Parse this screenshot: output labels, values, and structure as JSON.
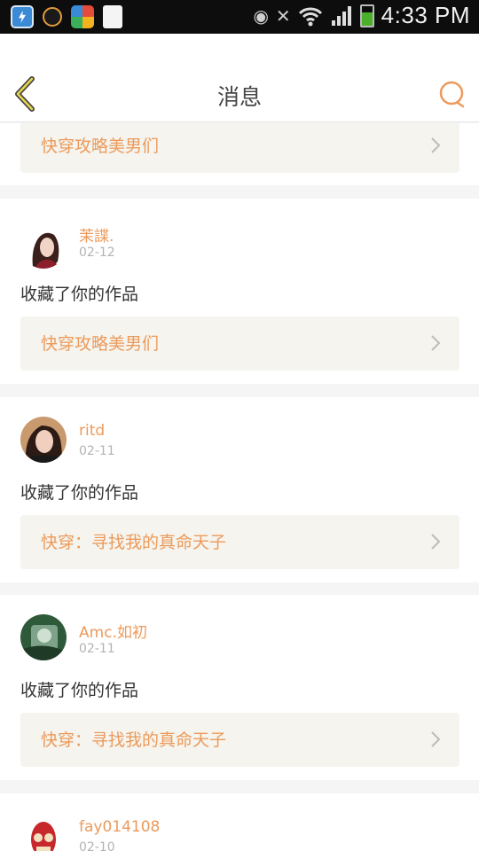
{
  "status_bar": {
    "time": "4:33 PM",
    "icons": [
      "shield-app-icon",
      "face-app-icon",
      "pinwheel-app-icon",
      "document-app-icon",
      "eye-icon",
      "mute-icon",
      "wifi-icon",
      "signal-icon",
      "battery-icon"
    ]
  },
  "header": {
    "title": "消息",
    "back_icon": "chevron-left-icon",
    "search_icon": "search-icon"
  },
  "colors": {
    "accent": "#ec9a5b",
    "back_icon": "#c9b400",
    "link_bg": "#f5f4ee"
  },
  "messages": [
    {
      "partial": true,
      "work_title": "快穿攻略美男们"
    },
    {
      "user": "茉諜.",
      "date": "02-12",
      "action": "收藏了你的作品",
      "work_title": "快穿攻略美男们"
    },
    {
      "user": "ritd",
      "date": "02-11",
      "action": "收藏了你的作品",
      "work_title": "快穿：寻找我的真命天子"
    },
    {
      "user": "Amc.如初",
      "date": "02-11",
      "action": "收藏了你的作品",
      "work_title": "快穿：寻找我的真命天子"
    },
    {
      "user": "fay014108",
      "date": "02-10"
    }
  ]
}
